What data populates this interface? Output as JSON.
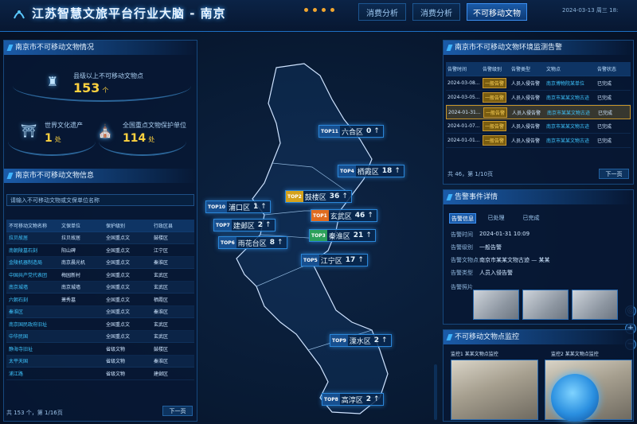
{
  "header": {
    "title": "江苏智慧文旅平台行业大脑 - 南京",
    "tabs": [
      "消费分析",
      "消费分析",
      "不可移动文物"
    ],
    "datetime": "2024-03-13  周三  18:"
  },
  "left": {
    "summary_title": "南京市不可移动文物情况",
    "main_stat": {
      "label": "县级以上不可移动文物点",
      "value": "153",
      "unit": "个"
    },
    "world_heritage": {
      "label": "世界文化遗产",
      "value": "1",
      "unit": "处"
    },
    "national_units": {
      "label": "全国重点文物保护单位",
      "value": "114",
      "unit": "处"
    },
    "info_title": "南京市不可移动文物信息",
    "search_placeholder": "请输入不可移动文物或文保单位名称",
    "table_headers": [
      "不可移动文物名称",
      "文保单位",
      "保护级别",
      "行政区县"
    ],
    "table_rows": [
      [
        "拉贝故居",
        "拉贝故居",
        "全国重点文",
        "鼓楼区"
      ],
      [
        "南朝陵墓石刻",
        "阳山碑",
        "全国重点文",
        "江宁区"
      ],
      [
        "金陵机器制造局",
        "南京晨光机",
        "全国重点文",
        "秦淮区"
      ],
      [
        "中国共产党代表团",
        "梅园新村",
        "全国重点文",
        "玄武区"
      ],
      [
        "南京城墙",
        "南京城墙",
        "全国重点文",
        "玄武区"
      ],
      [
        "六朝石刻",
        "萧秀墓",
        "全国重点文",
        "栖霞区"
      ],
      [
        "秦淮区",
        "",
        "全国重点文",
        "秦淮区"
      ],
      [
        "南京国民政府旧址",
        "",
        "全国重点文",
        "玄武区"
      ],
      [
        "中华民国",
        "",
        "全国重点文",
        "玄武区"
      ],
      [
        "静海寺旧址",
        "",
        "省级文物",
        "鼓楼区"
      ],
      [
        "太平天国",
        "",
        "省级文物",
        "秦淮区"
      ],
      [
        "浦江路",
        "",
        "省级文物",
        "建邺区"
      ]
    ],
    "footer": "共 153 个，第 1/16页",
    "next": "下一页"
  },
  "map": {
    "labels": [
      {
        "rank": "TOP11",
        "name": "六合区",
        "value": "0"
      },
      {
        "rank": "TOP4",
        "name": "栖霞区",
        "value": "18"
      },
      {
        "rank": "TOP2",
        "name": "鼓楼区",
        "value": "36"
      },
      {
        "rank": "TOP10",
        "name": "浦口区",
        "value": "1"
      },
      {
        "rank": "TOP1",
        "name": "玄武区",
        "value": "46"
      },
      {
        "rank": "TOP7",
        "name": "建邺区",
        "value": "2"
      },
      {
        "rank": "TOP3",
        "name": "秦淮区",
        "value": "21"
      },
      {
        "rank": "TOP6",
        "name": "雨花台区",
        "value": "8"
      },
      {
        "rank": "TOP5",
        "name": "江宁区",
        "value": "17"
      },
      {
        "rank": "TOP9",
        "name": "溧水区",
        "value": "2"
      },
      {
        "rank": "TOP8",
        "name": "高淳区",
        "value": "2"
      }
    ],
    "arrow": "↑",
    "controls": [
      "+",
      "−"
    ]
  },
  "right": {
    "monitor_title": "南京市不可移动文物环境监测告警",
    "table_headers": [
      "告警时间",
      "告警级别",
      "告警类型",
      "文物点",
      "告警状态"
    ],
    "rows": [
      [
        "2024-03-08...",
        "一般告警",
        "人员入侵告警",
        "南京博物院某单位",
        "已完成"
      ],
      [
        "2024-03-05...",
        "一般告警",
        "人员入侵告警",
        "南京市某某文物古迹",
        "已完成"
      ],
      [
        "2024-01-31...",
        "一般告警",
        "人员入侵告警",
        "南京市某某文物古迹",
        "已完成"
      ],
      [
        "2024-01-07...",
        "一般告警",
        "人员入侵告警",
        "南京市某某文物古迹",
        "已完成"
      ],
      [
        "2024-01-01...",
        "一般告警",
        "人员入侵告警",
        "南京市某某文物古迹",
        "已完成"
      ]
    ],
    "footer": "共 46，第 1/10页",
    "next": "下一页",
    "event_title": "告警事件详情",
    "event_tabs": [
      "告警信息",
      "已处理",
      "已完成"
    ],
    "details": [
      {
        "k": "告警时间",
        "v": "2024-01-31  10:09"
      },
      {
        "k": "告警级别",
        "v": "一般告警"
      },
      {
        "k": "告警文物点",
        "v": "南京市某某文物古迹 — 某某"
      },
      {
        "k": "告警类型",
        "v": "人员入侵告警"
      },
      {
        "k": "告警照片",
        "v": ""
      }
    ],
    "camera_title": "不可移动文物点监控",
    "cameras": [
      "监控1 某某文物点监控",
      "监控2 某某文物点监控"
    ]
  },
  "colors": {
    "accent": "#3ea3ff",
    "highlight": "#ffd23f",
    "top1": "#e06b1f",
    "top2": "#d4a21c",
    "top3": "#2ca05a"
  }
}
